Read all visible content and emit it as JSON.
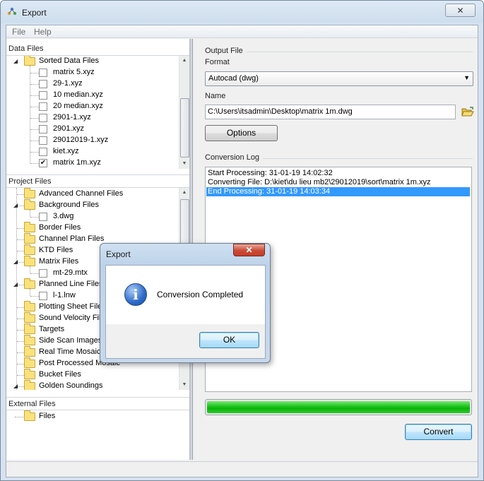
{
  "window": {
    "title": "Export",
    "close_glyph": "✕"
  },
  "menu": [
    "File",
    "Help"
  ],
  "data_files": {
    "header": "Data Files",
    "root": "Sorted Data Files",
    "items": [
      {
        "label": "matrix 5.xyz",
        "checked": false
      },
      {
        "label": "29-1.xyz",
        "checked": false
      },
      {
        "label": "10 median.xyz",
        "checked": false
      },
      {
        "label": "20 median.xyz",
        "checked": false
      },
      {
        "label": "2901-1.xyz",
        "checked": false
      },
      {
        "label": "2901.xyz",
        "checked": false
      },
      {
        "label": "29012019-1.xyz",
        "checked": false
      },
      {
        "label": "kiet.xyz",
        "checked": false
      },
      {
        "label": "matrix 1m.xyz",
        "checked": true
      }
    ]
  },
  "project_files": {
    "header": "Project Files",
    "rows": [
      {
        "label": "Advanced Channel Files",
        "kind": "folder",
        "level": 1,
        "expander": ""
      },
      {
        "label": "Background Files",
        "kind": "folder",
        "level": 1,
        "expander": "◢"
      },
      {
        "label": "3.dwg",
        "kind": "file",
        "level": 2,
        "expander": ""
      },
      {
        "label": "Border Files",
        "kind": "folder",
        "level": 1,
        "expander": ""
      },
      {
        "label": "Channel Plan Files",
        "kind": "folder",
        "level": 1,
        "expander": ""
      },
      {
        "label": "KTD Files",
        "kind": "folder",
        "level": 1,
        "expander": ""
      },
      {
        "label": "Matrix Files",
        "kind": "folder",
        "level": 1,
        "expander": "◢"
      },
      {
        "label": "mt-29.mtx",
        "kind": "file",
        "level": 2,
        "expander": ""
      },
      {
        "label": "Planned Line Files",
        "kind": "folder",
        "level": 1,
        "expander": "◢"
      },
      {
        "label": "l-1.lnw",
        "kind": "file",
        "level": 2,
        "expander": ""
      },
      {
        "label": "Plotting Sheet Files",
        "kind": "folder",
        "level": 1,
        "expander": ""
      },
      {
        "label": "Sound Velocity Files",
        "kind": "folder",
        "level": 1,
        "expander": ""
      },
      {
        "label": "Targets",
        "kind": "folder",
        "level": 1,
        "expander": ""
      },
      {
        "label": "Side Scan Images",
        "kind": "folder",
        "level": 1,
        "expander": ""
      },
      {
        "label": "Real Time Mosaic",
        "kind": "folder",
        "level": 1,
        "expander": ""
      },
      {
        "label": "Post Processed Mosaic",
        "kind": "folder",
        "level": 1,
        "expander": ""
      },
      {
        "label": "Bucket Files",
        "kind": "folder",
        "level": 1,
        "expander": ""
      },
      {
        "label": "Golden Soundings",
        "kind": "folder",
        "level": 1,
        "expander": "◢"
      }
    ]
  },
  "external_files": {
    "header": "External Files",
    "item": "Files"
  },
  "output": {
    "group_label": "Output File",
    "format_label": "Format",
    "format_value": "Autocad (dwg)",
    "name_label": "Name",
    "name_value": "C:\\Users\\itsadmin\\Desktop\\matrix 1m.dwg",
    "options_button": "Options"
  },
  "log": {
    "group_label": "Conversion Log",
    "lines": [
      "Start Processing: 31-01-19 14:02:32",
      "Converting File: D:\\kiet\\du lieu mb2\\29012019\\sort\\matrix 1m.xyz",
      "End Processing: 31-01-19 14:03:34"
    ],
    "selected_line": 2
  },
  "progress": {
    "value": 1.0
  },
  "convert_button": "Convert",
  "dialog": {
    "title": "Export",
    "close_glyph": "✕",
    "icon": "info-icon",
    "message": "Conversion Completed",
    "ok_button": "OK"
  }
}
